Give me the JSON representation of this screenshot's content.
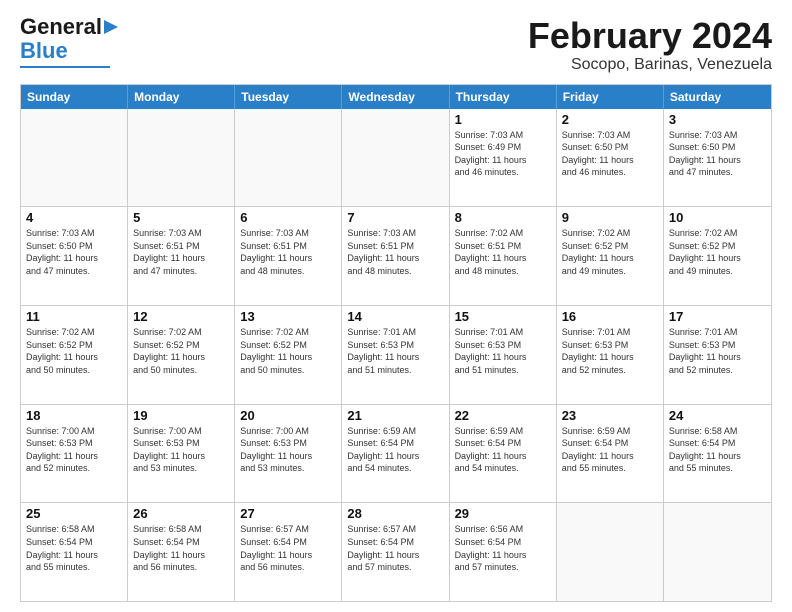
{
  "logo": {
    "line1": "General",
    "line2": "Blue"
  },
  "title": "February 2024",
  "subtitle": "Socopo, Barinas, Venezuela",
  "days": [
    "Sunday",
    "Monday",
    "Tuesday",
    "Wednesday",
    "Thursday",
    "Friday",
    "Saturday"
  ],
  "weeks": [
    [
      {
        "day": "",
        "text": ""
      },
      {
        "day": "",
        "text": ""
      },
      {
        "day": "",
        "text": ""
      },
      {
        "day": "",
        "text": ""
      },
      {
        "day": "1",
        "text": "Sunrise: 7:03 AM\nSunset: 6:49 PM\nDaylight: 11 hours\nand 46 minutes."
      },
      {
        "day": "2",
        "text": "Sunrise: 7:03 AM\nSunset: 6:50 PM\nDaylight: 11 hours\nand 46 minutes."
      },
      {
        "day": "3",
        "text": "Sunrise: 7:03 AM\nSunset: 6:50 PM\nDaylight: 11 hours\nand 47 minutes."
      }
    ],
    [
      {
        "day": "4",
        "text": "Sunrise: 7:03 AM\nSunset: 6:50 PM\nDaylight: 11 hours\nand 47 minutes."
      },
      {
        "day": "5",
        "text": "Sunrise: 7:03 AM\nSunset: 6:51 PM\nDaylight: 11 hours\nand 47 minutes."
      },
      {
        "day": "6",
        "text": "Sunrise: 7:03 AM\nSunset: 6:51 PM\nDaylight: 11 hours\nand 48 minutes."
      },
      {
        "day": "7",
        "text": "Sunrise: 7:03 AM\nSunset: 6:51 PM\nDaylight: 11 hours\nand 48 minutes."
      },
      {
        "day": "8",
        "text": "Sunrise: 7:02 AM\nSunset: 6:51 PM\nDaylight: 11 hours\nand 48 minutes."
      },
      {
        "day": "9",
        "text": "Sunrise: 7:02 AM\nSunset: 6:52 PM\nDaylight: 11 hours\nand 49 minutes."
      },
      {
        "day": "10",
        "text": "Sunrise: 7:02 AM\nSunset: 6:52 PM\nDaylight: 11 hours\nand 49 minutes."
      }
    ],
    [
      {
        "day": "11",
        "text": "Sunrise: 7:02 AM\nSunset: 6:52 PM\nDaylight: 11 hours\nand 50 minutes."
      },
      {
        "day": "12",
        "text": "Sunrise: 7:02 AM\nSunset: 6:52 PM\nDaylight: 11 hours\nand 50 minutes."
      },
      {
        "day": "13",
        "text": "Sunrise: 7:02 AM\nSunset: 6:52 PM\nDaylight: 11 hours\nand 50 minutes."
      },
      {
        "day": "14",
        "text": "Sunrise: 7:01 AM\nSunset: 6:53 PM\nDaylight: 11 hours\nand 51 minutes."
      },
      {
        "day": "15",
        "text": "Sunrise: 7:01 AM\nSunset: 6:53 PM\nDaylight: 11 hours\nand 51 minutes."
      },
      {
        "day": "16",
        "text": "Sunrise: 7:01 AM\nSunset: 6:53 PM\nDaylight: 11 hours\nand 52 minutes."
      },
      {
        "day": "17",
        "text": "Sunrise: 7:01 AM\nSunset: 6:53 PM\nDaylight: 11 hours\nand 52 minutes."
      }
    ],
    [
      {
        "day": "18",
        "text": "Sunrise: 7:00 AM\nSunset: 6:53 PM\nDaylight: 11 hours\nand 52 minutes."
      },
      {
        "day": "19",
        "text": "Sunrise: 7:00 AM\nSunset: 6:53 PM\nDaylight: 11 hours\nand 53 minutes."
      },
      {
        "day": "20",
        "text": "Sunrise: 7:00 AM\nSunset: 6:53 PM\nDaylight: 11 hours\nand 53 minutes."
      },
      {
        "day": "21",
        "text": "Sunrise: 6:59 AM\nSunset: 6:54 PM\nDaylight: 11 hours\nand 54 minutes."
      },
      {
        "day": "22",
        "text": "Sunrise: 6:59 AM\nSunset: 6:54 PM\nDaylight: 11 hours\nand 54 minutes."
      },
      {
        "day": "23",
        "text": "Sunrise: 6:59 AM\nSunset: 6:54 PM\nDaylight: 11 hours\nand 55 minutes."
      },
      {
        "day": "24",
        "text": "Sunrise: 6:58 AM\nSunset: 6:54 PM\nDaylight: 11 hours\nand 55 minutes."
      }
    ],
    [
      {
        "day": "25",
        "text": "Sunrise: 6:58 AM\nSunset: 6:54 PM\nDaylight: 11 hours\nand 55 minutes."
      },
      {
        "day": "26",
        "text": "Sunrise: 6:58 AM\nSunset: 6:54 PM\nDaylight: 11 hours\nand 56 minutes."
      },
      {
        "day": "27",
        "text": "Sunrise: 6:57 AM\nSunset: 6:54 PM\nDaylight: 11 hours\nand 56 minutes."
      },
      {
        "day": "28",
        "text": "Sunrise: 6:57 AM\nSunset: 6:54 PM\nDaylight: 11 hours\nand 57 minutes."
      },
      {
        "day": "29",
        "text": "Sunrise: 6:56 AM\nSunset: 6:54 PM\nDaylight: 11 hours\nand 57 minutes."
      },
      {
        "day": "",
        "text": ""
      },
      {
        "day": "",
        "text": ""
      }
    ]
  ]
}
